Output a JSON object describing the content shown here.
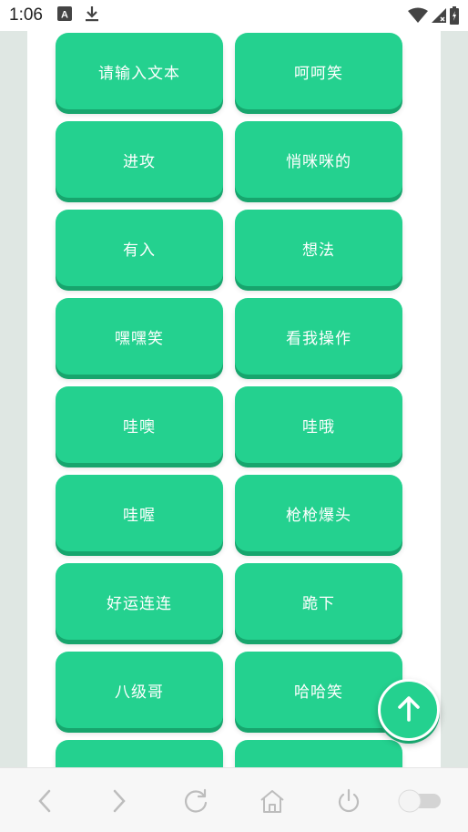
{
  "status_bar": {
    "time": "1:06",
    "icons": [
      "text-a-icon",
      "download-icon",
      "wifi-icon",
      "signal-icon",
      "battery-icon"
    ]
  },
  "buttons": [
    "请输入文本",
    "呵呵笑",
    "进攻",
    "悄咪咪的",
    "有入",
    "想法",
    "嘿嘿笑",
    "看我操作",
    "哇噢",
    "哇哦",
    "哇喔",
    "枪枪爆头",
    "好运连连",
    "跪下",
    "八级哥",
    "哈哈笑",
    "",
    ""
  ],
  "fab_icon": "arrow-up-icon",
  "bottom_nav": [
    "back-icon",
    "forward-icon",
    "refresh-icon",
    "home-icon",
    "power-icon",
    "toggle-switch"
  ],
  "colors": {
    "accent": "#24d18f",
    "accent_shadow": "#17a56d",
    "side_strip": "#dfe7e3"
  }
}
